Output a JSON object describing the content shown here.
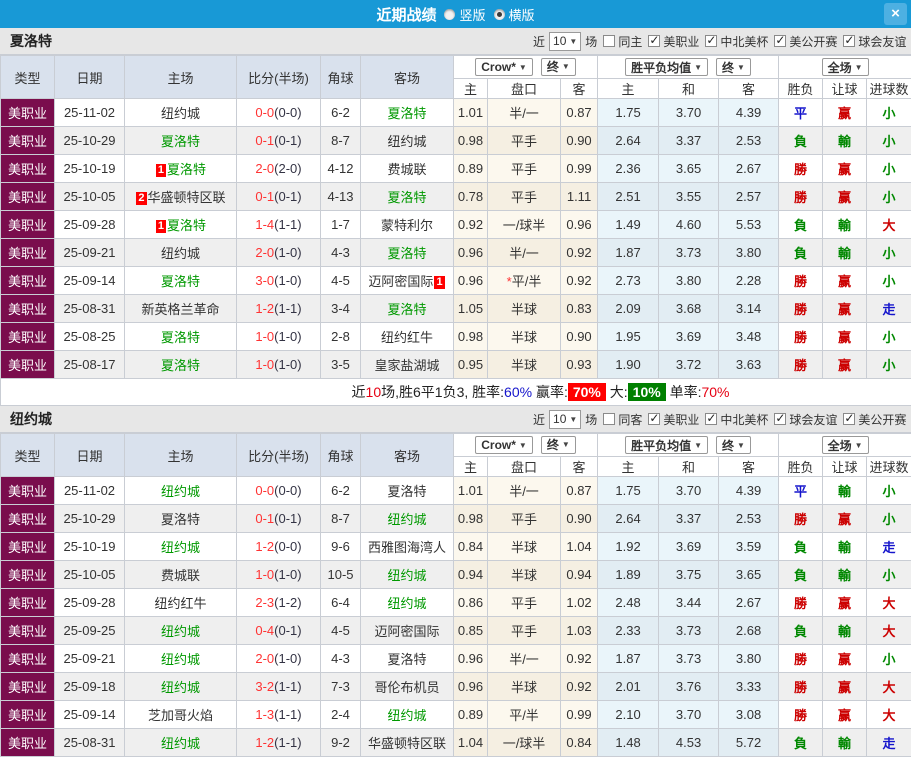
{
  "colors": {
    "accent_blue": "#1899d6",
    "maroon": "#7a0d4d",
    "win_red": "#cc0000",
    "lose_green": "#008800",
    "draw_blue": "#1515cc",
    "team_green": "#009900",
    "score_red": "#ff3333",
    "badge_red": "#ff0000",
    "rate_red_bg": "#ff0000",
    "rate_green_bg": "#008000"
  },
  "glyphs": {
    "caret": "▼",
    "close": "×"
  },
  "titlebar": {
    "title": "近期战绩",
    "radio_vertical": "竖版",
    "radio_horizontal": "横版",
    "selected": "横版"
  },
  "header": {
    "main": [
      "类型",
      "日期",
      "主场",
      "比分(半场)",
      "角球",
      "客场"
    ],
    "groups": [
      {
        "buttons": [
          "Crow*",
          "终"
        ]
      },
      {
        "buttons": [
          "胜平负均值",
          "终"
        ]
      },
      {
        "buttons": [
          "全场"
        ]
      }
    ],
    "sub": [
      "主",
      "盘口",
      "客",
      "主",
      "和",
      "客",
      "胜负",
      "让球",
      "进球数"
    ]
  },
  "sections": [
    {
      "team": "夏洛特",
      "filter": {
        "near_label": "近",
        "count": "10",
        "matches_label": "场",
        "same_label": "同主",
        "leagues": [
          "美职业",
          "中北美杯",
          "美公开赛",
          "球会友谊"
        ]
      },
      "rows": [
        {
          "type": "美职业",
          "date": "25-11-02",
          "home": {
            "name": "纽约城",
            "green": false
          },
          "score": {
            "full": "0-0",
            "half": "(0-0)"
          },
          "corner": "6-2",
          "away": {
            "name": "夏洛特",
            "green": true
          },
          "odds": [
            "1.01",
            "半/一",
            "0.87"
          ],
          "mean": [
            "1.75",
            "3.70",
            "4.39"
          ],
          "results": [
            {
              "t": "平",
              "s": "blue"
            },
            {
              "t": "赢",
              "s": "red"
            },
            {
              "t": "小",
              "s": "green"
            }
          ]
        },
        {
          "type": "美职业",
          "date": "25-10-29",
          "home": {
            "name": "夏洛特",
            "green": true
          },
          "score": {
            "full": "0-1",
            "half": "(0-1)"
          },
          "corner": "8-7",
          "away": {
            "name": "纽约城",
            "green": false
          },
          "odds": [
            "0.98",
            "平手",
            "0.90"
          ],
          "mean": [
            "2.64",
            "3.37",
            "2.53"
          ],
          "results": [
            {
              "t": "負",
              "s": "green"
            },
            {
              "t": "輸",
              "s": "green"
            },
            {
              "t": "小",
              "s": "green"
            }
          ]
        },
        {
          "type": "美职业",
          "date": "25-10-19",
          "home": {
            "name": "夏洛特",
            "green": true,
            "badge": "1",
            "badge_pos": "before"
          },
          "score": {
            "full": "2-0",
            "half": "(2-0)"
          },
          "corner": "4-12",
          "away": {
            "name": "费城联",
            "green": false
          },
          "odds": [
            "0.89",
            "平手",
            "0.99"
          ],
          "mean": [
            "2.36",
            "3.65",
            "2.67"
          ],
          "results": [
            {
              "t": "勝",
              "s": "red"
            },
            {
              "t": "赢",
              "s": "red"
            },
            {
              "t": "小",
              "s": "green"
            }
          ]
        },
        {
          "type": "美职业",
          "date": "25-10-05",
          "home": {
            "name": "华盛顿特区联",
            "green": false,
            "badge": "2",
            "badge_pos": "before"
          },
          "score": {
            "full": "0-1",
            "half": "(0-1)"
          },
          "corner": "4-13",
          "away": {
            "name": "夏洛特",
            "green": true
          },
          "odds": [
            "0.78",
            "平手",
            "1.11"
          ],
          "mean": [
            "2.51",
            "3.55",
            "2.57"
          ],
          "results": [
            {
              "t": "勝",
              "s": "red"
            },
            {
              "t": "赢",
              "s": "red"
            },
            {
              "t": "小",
              "s": "green"
            }
          ]
        },
        {
          "type": "美职业",
          "date": "25-09-28",
          "home": {
            "name": "夏洛特",
            "green": true,
            "badge": "1",
            "badge_pos": "before"
          },
          "score": {
            "full": "1-4",
            "half": "(1-1)"
          },
          "corner": "1-7",
          "away": {
            "name": "蒙特利尔",
            "green": false
          },
          "odds": [
            "0.92",
            "一/球半",
            "0.96"
          ],
          "mean": [
            "1.49",
            "4.60",
            "5.53"
          ],
          "results": [
            {
              "t": "負",
              "s": "green"
            },
            {
              "t": "輸",
              "s": "green"
            },
            {
              "t": "大",
              "s": "red"
            }
          ]
        },
        {
          "type": "美职业",
          "date": "25-09-21",
          "home": {
            "name": "纽约城",
            "green": false
          },
          "score": {
            "full": "2-0",
            "half": "(1-0)"
          },
          "corner": "4-3",
          "away": {
            "name": "夏洛特",
            "green": true
          },
          "odds": [
            "0.96",
            "半/一",
            "0.92"
          ],
          "mean": [
            "1.87",
            "3.73",
            "3.80"
          ],
          "results": [
            {
              "t": "負",
              "s": "green"
            },
            {
              "t": "輸",
              "s": "green"
            },
            {
              "t": "小",
              "s": "green"
            }
          ]
        },
        {
          "type": "美职业",
          "date": "25-09-14",
          "home": {
            "name": "夏洛特",
            "green": true
          },
          "score": {
            "full": "3-0",
            "half": "(1-0)"
          },
          "corner": "4-5",
          "away": {
            "name": "迈阿密国际",
            "green": false,
            "badge": "1",
            "badge_pos": "after"
          },
          "hcap_mark": "*",
          "odds": [
            "0.96",
            "平/半",
            "0.92"
          ],
          "mean": [
            "2.73",
            "3.80",
            "2.28"
          ],
          "results": [
            {
              "t": "勝",
              "s": "red"
            },
            {
              "t": "赢",
              "s": "red"
            },
            {
              "t": "小",
              "s": "green"
            }
          ]
        },
        {
          "type": "美职业",
          "date": "25-08-31",
          "home": {
            "name": "新英格兰革命",
            "green": false
          },
          "score": {
            "full": "1-2",
            "half": "(1-1)"
          },
          "corner": "3-4",
          "away": {
            "name": "夏洛特",
            "green": true
          },
          "odds": [
            "1.05",
            "半球",
            "0.83"
          ],
          "mean": [
            "2.09",
            "3.68",
            "3.14"
          ],
          "results": [
            {
              "t": "勝",
              "s": "red"
            },
            {
              "t": "赢",
              "s": "red"
            },
            {
              "t": "走",
              "s": "blue"
            }
          ]
        },
        {
          "type": "美职业",
          "date": "25-08-25",
          "home": {
            "name": "夏洛特",
            "green": true
          },
          "score": {
            "full": "1-0",
            "half": "(1-0)"
          },
          "corner": "2-8",
          "away": {
            "name": "纽约红牛",
            "green": false
          },
          "odds": [
            "0.98",
            "半球",
            "0.90"
          ],
          "mean": [
            "1.95",
            "3.69",
            "3.48"
          ],
          "results": [
            {
              "t": "勝",
              "s": "red"
            },
            {
              "t": "赢",
              "s": "red"
            },
            {
              "t": "小",
              "s": "green"
            }
          ]
        },
        {
          "type": "美职业",
          "date": "25-08-17",
          "home": {
            "name": "夏洛特",
            "green": true
          },
          "score": {
            "full": "1-0",
            "half": "(1-0)"
          },
          "corner": "3-5",
          "away": {
            "name": "皇家盐湖城",
            "green": false
          },
          "odds": [
            "0.95",
            "半球",
            "0.93"
          ],
          "mean": [
            "1.90",
            "3.72",
            "3.63"
          ],
          "results": [
            {
              "t": "勝",
              "s": "red"
            },
            {
              "t": "赢",
              "s": "red"
            },
            {
              "t": "小",
              "s": "green"
            }
          ]
        }
      ],
      "summary": [
        {
          "t": "近"
        },
        {
          "t": "10",
          "s": "red"
        },
        {
          "t": "场,胜6平1负3, 胜率:"
        },
        {
          "t": "60%",
          "s": "blue"
        },
        {
          "t": " 赢率:"
        },
        {
          "t": "70%",
          "s": "badge-red"
        },
        {
          "t": " 大:"
        },
        {
          "t": "10%",
          "s": "badge-green"
        },
        {
          "t": " 单率:"
        },
        {
          "t": "70%",
          "s": "red"
        }
      ]
    },
    {
      "team": "纽约城",
      "filter": {
        "near_label": "近",
        "count": "10",
        "matches_label": "场",
        "same_label": "同客",
        "leagues": [
          "美职业",
          "中北美杯",
          "球会友谊",
          "美公开赛"
        ]
      },
      "rows": [
        {
          "type": "美职业",
          "date": "25-11-02",
          "home": {
            "name": "纽约城",
            "green": true
          },
          "score": {
            "full": "0-0",
            "half": "(0-0)"
          },
          "corner": "6-2",
          "away": {
            "name": "夏洛特",
            "green": false
          },
          "odds": [
            "1.01",
            "半/一",
            "0.87"
          ],
          "mean": [
            "1.75",
            "3.70",
            "4.39"
          ],
          "results": [
            {
              "t": "平",
              "s": "blue"
            },
            {
              "t": "輸",
              "s": "green"
            },
            {
              "t": "小",
              "s": "green"
            }
          ]
        },
        {
          "type": "美职业",
          "date": "25-10-29",
          "home": {
            "name": "夏洛特",
            "green": false
          },
          "score": {
            "full": "0-1",
            "half": "(0-1)"
          },
          "corner": "8-7",
          "away": {
            "name": "纽约城",
            "green": true
          },
          "odds": [
            "0.98",
            "平手",
            "0.90"
          ],
          "mean": [
            "2.64",
            "3.37",
            "2.53"
          ],
          "results": [
            {
              "t": "勝",
              "s": "red"
            },
            {
              "t": "赢",
              "s": "red"
            },
            {
              "t": "小",
              "s": "green"
            }
          ]
        },
        {
          "type": "美职业",
          "date": "25-10-19",
          "home": {
            "name": "纽约城",
            "green": true
          },
          "score": {
            "full": "1-2",
            "half": "(0-0)"
          },
          "corner": "9-6",
          "away": {
            "name": "西雅图海湾人",
            "green": false
          },
          "odds": [
            "0.84",
            "半球",
            "1.04"
          ],
          "mean": [
            "1.92",
            "3.69",
            "3.59"
          ],
          "results": [
            {
              "t": "負",
              "s": "green"
            },
            {
              "t": "輸",
              "s": "green"
            },
            {
              "t": "走",
              "s": "blue"
            }
          ]
        },
        {
          "type": "美职业",
          "date": "25-10-05",
          "home": {
            "name": "费城联",
            "green": false
          },
          "score": {
            "full": "1-0",
            "half": "(1-0)"
          },
          "corner": "10-5",
          "away": {
            "name": "纽约城",
            "green": true
          },
          "odds": [
            "0.94",
            "半球",
            "0.94"
          ],
          "mean": [
            "1.89",
            "3.75",
            "3.65"
          ],
          "results": [
            {
              "t": "負",
              "s": "green"
            },
            {
              "t": "輸",
              "s": "green"
            },
            {
              "t": "小",
              "s": "green"
            }
          ]
        },
        {
          "type": "美职业",
          "date": "25-09-28",
          "home": {
            "name": "纽约红牛",
            "green": false
          },
          "score": {
            "full": "2-3",
            "half": "(1-2)"
          },
          "corner": "6-4",
          "away": {
            "name": "纽约城",
            "green": true
          },
          "odds": [
            "0.86",
            "平手",
            "1.02"
          ],
          "mean": [
            "2.48",
            "3.44",
            "2.67"
          ],
          "results": [
            {
              "t": "勝",
              "s": "red"
            },
            {
              "t": "赢",
              "s": "red"
            },
            {
              "t": "大",
              "s": "red"
            }
          ]
        },
        {
          "type": "美职业",
          "date": "25-09-25",
          "home": {
            "name": "纽约城",
            "green": true
          },
          "score": {
            "full": "0-4",
            "half": "(0-1)"
          },
          "corner": "4-5",
          "away": {
            "name": "迈阿密国际",
            "green": false
          },
          "odds": [
            "0.85",
            "平手",
            "1.03"
          ],
          "mean": [
            "2.33",
            "3.73",
            "2.68"
          ],
          "results": [
            {
              "t": "負",
              "s": "green"
            },
            {
              "t": "輸",
              "s": "green"
            },
            {
              "t": "大",
              "s": "red"
            }
          ]
        },
        {
          "type": "美职业",
          "date": "25-09-21",
          "home": {
            "name": "纽约城",
            "green": true
          },
          "score": {
            "full": "2-0",
            "half": "(1-0)"
          },
          "corner": "4-3",
          "away": {
            "name": "夏洛特",
            "green": false
          },
          "odds": [
            "0.96",
            "半/一",
            "0.92"
          ],
          "mean": [
            "1.87",
            "3.73",
            "3.80"
          ],
          "results": [
            {
              "t": "勝",
              "s": "red"
            },
            {
              "t": "赢",
              "s": "red"
            },
            {
              "t": "小",
              "s": "green"
            }
          ]
        },
        {
          "type": "美职业",
          "date": "25-09-18",
          "home": {
            "name": "纽约城",
            "green": true
          },
          "score": {
            "full": "3-2",
            "half": "(1-1)"
          },
          "corner": "7-3",
          "away": {
            "name": "哥伦布机员",
            "green": false
          },
          "odds": [
            "0.96",
            "半球",
            "0.92"
          ],
          "mean": [
            "2.01",
            "3.76",
            "3.33"
          ],
          "results": [
            {
              "t": "勝",
              "s": "red"
            },
            {
              "t": "赢",
              "s": "red"
            },
            {
              "t": "大",
              "s": "red"
            }
          ]
        },
        {
          "type": "美职业",
          "date": "25-09-14",
          "home": {
            "name": "芝加哥火焰",
            "green": false
          },
          "score": {
            "full": "1-3",
            "half": "(1-1)"
          },
          "corner": "2-4",
          "away": {
            "name": "纽约城",
            "green": true
          },
          "odds": [
            "0.89",
            "平/半",
            "0.99"
          ],
          "mean": [
            "2.10",
            "3.70",
            "3.08"
          ],
          "results": [
            {
              "t": "勝",
              "s": "red"
            },
            {
              "t": "赢",
              "s": "red"
            },
            {
              "t": "大",
              "s": "red"
            }
          ]
        },
        {
          "type": "美职业",
          "date": "25-08-31",
          "home": {
            "name": "纽约城",
            "green": true
          },
          "score": {
            "full": "1-2",
            "half": "(1-1)"
          },
          "corner": "9-2",
          "away": {
            "name": "华盛顿特区联",
            "green": false
          },
          "odds": [
            "1.04",
            "一/球半",
            "0.84"
          ],
          "mean": [
            "1.48",
            "4.53",
            "5.72"
          ],
          "results": [
            {
              "t": "負",
              "s": "green"
            },
            {
              "t": "輸",
              "s": "green"
            },
            {
              "t": "走",
              "s": "blue"
            }
          ]
        }
      ]
    }
  ]
}
